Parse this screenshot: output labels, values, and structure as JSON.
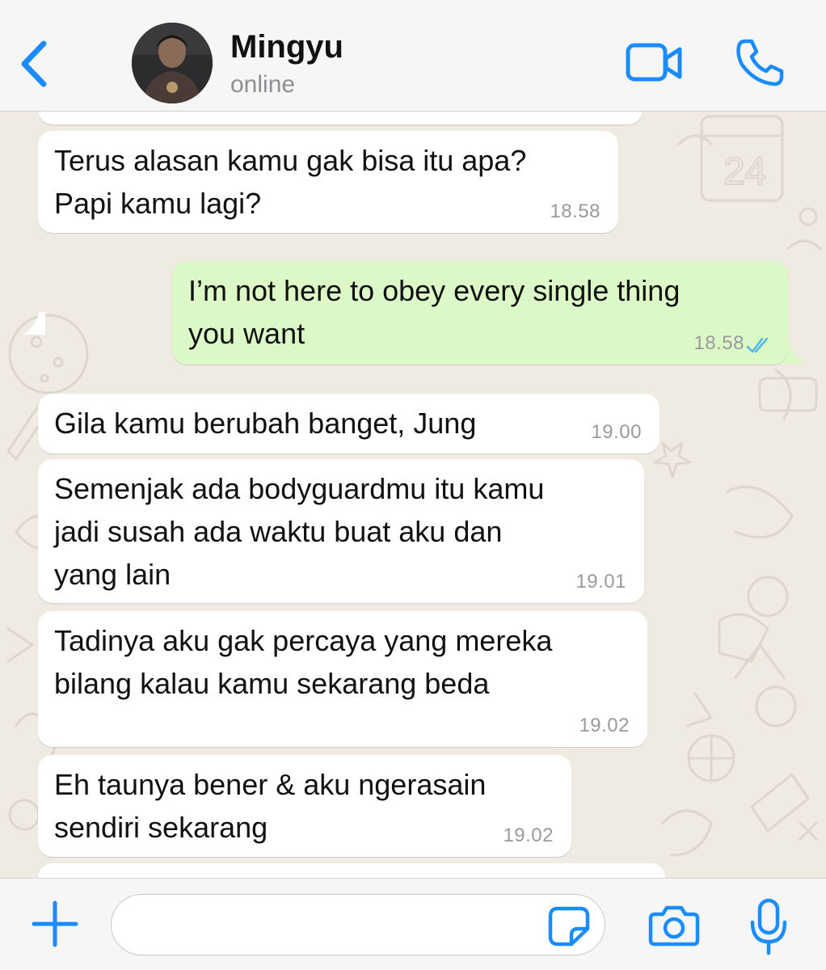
{
  "header": {
    "contact_name": "Mingyu",
    "status": "online"
  },
  "messages": [
    {
      "direction": "incoming",
      "text": "Terus alasan kamu gak bisa itu apa?\nPapi kamu lagi?",
      "time": "18.58"
    },
    {
      "direction": "outgoing",
      "text": "I’m not here to obey every single thing\nyou want",
      "time": "18.58",
      "read": true
    },
    {
      "direction": "incoming",
      "text": "Gila kamu berubah banget, Jung",
      "time": "19.00"
    },
    {
      "direction": "incoming",
      "text": "Semenjak ada bodyguardmu itu kamu\njadi susah ada waktu buat aku dan\nyang lain",
      "time": "19.01"
    },
    {
      "direction": "incoming",
      "text": "Tadinya aku gak percaya yang mereka\nbilang kalau kamu sekarang beda",
      "time": "19.02"
    },
    {
      "direction": "incoming",
      "text": "Eh taunya bener & aku ngerasain\nsendiri sekarang",
      "time": "19.02"
    }
  ],
  "input": {
    "placeholder": ""
  },
  "icons": {
    "back": "chevron-left-icon",
    "video": "video-camera-icon",
    "phone": "phone-icon",
    "plus": "plus-icon",
    "sticker": "sticker-icon",
    "camera": "camera-icon",
    "mic": "microphone-icon",
    "read_ticks": "double-check-icon"
  },
  "colors": {
    "accent": "#1a8cff",
    "outgoing_bubble": "#dcf8c6",
    "incoming_bubble": "#ffffff",
    "chat_background": "#efeae2",
    "read_ticks": "#4fb6ec"
  }
}
